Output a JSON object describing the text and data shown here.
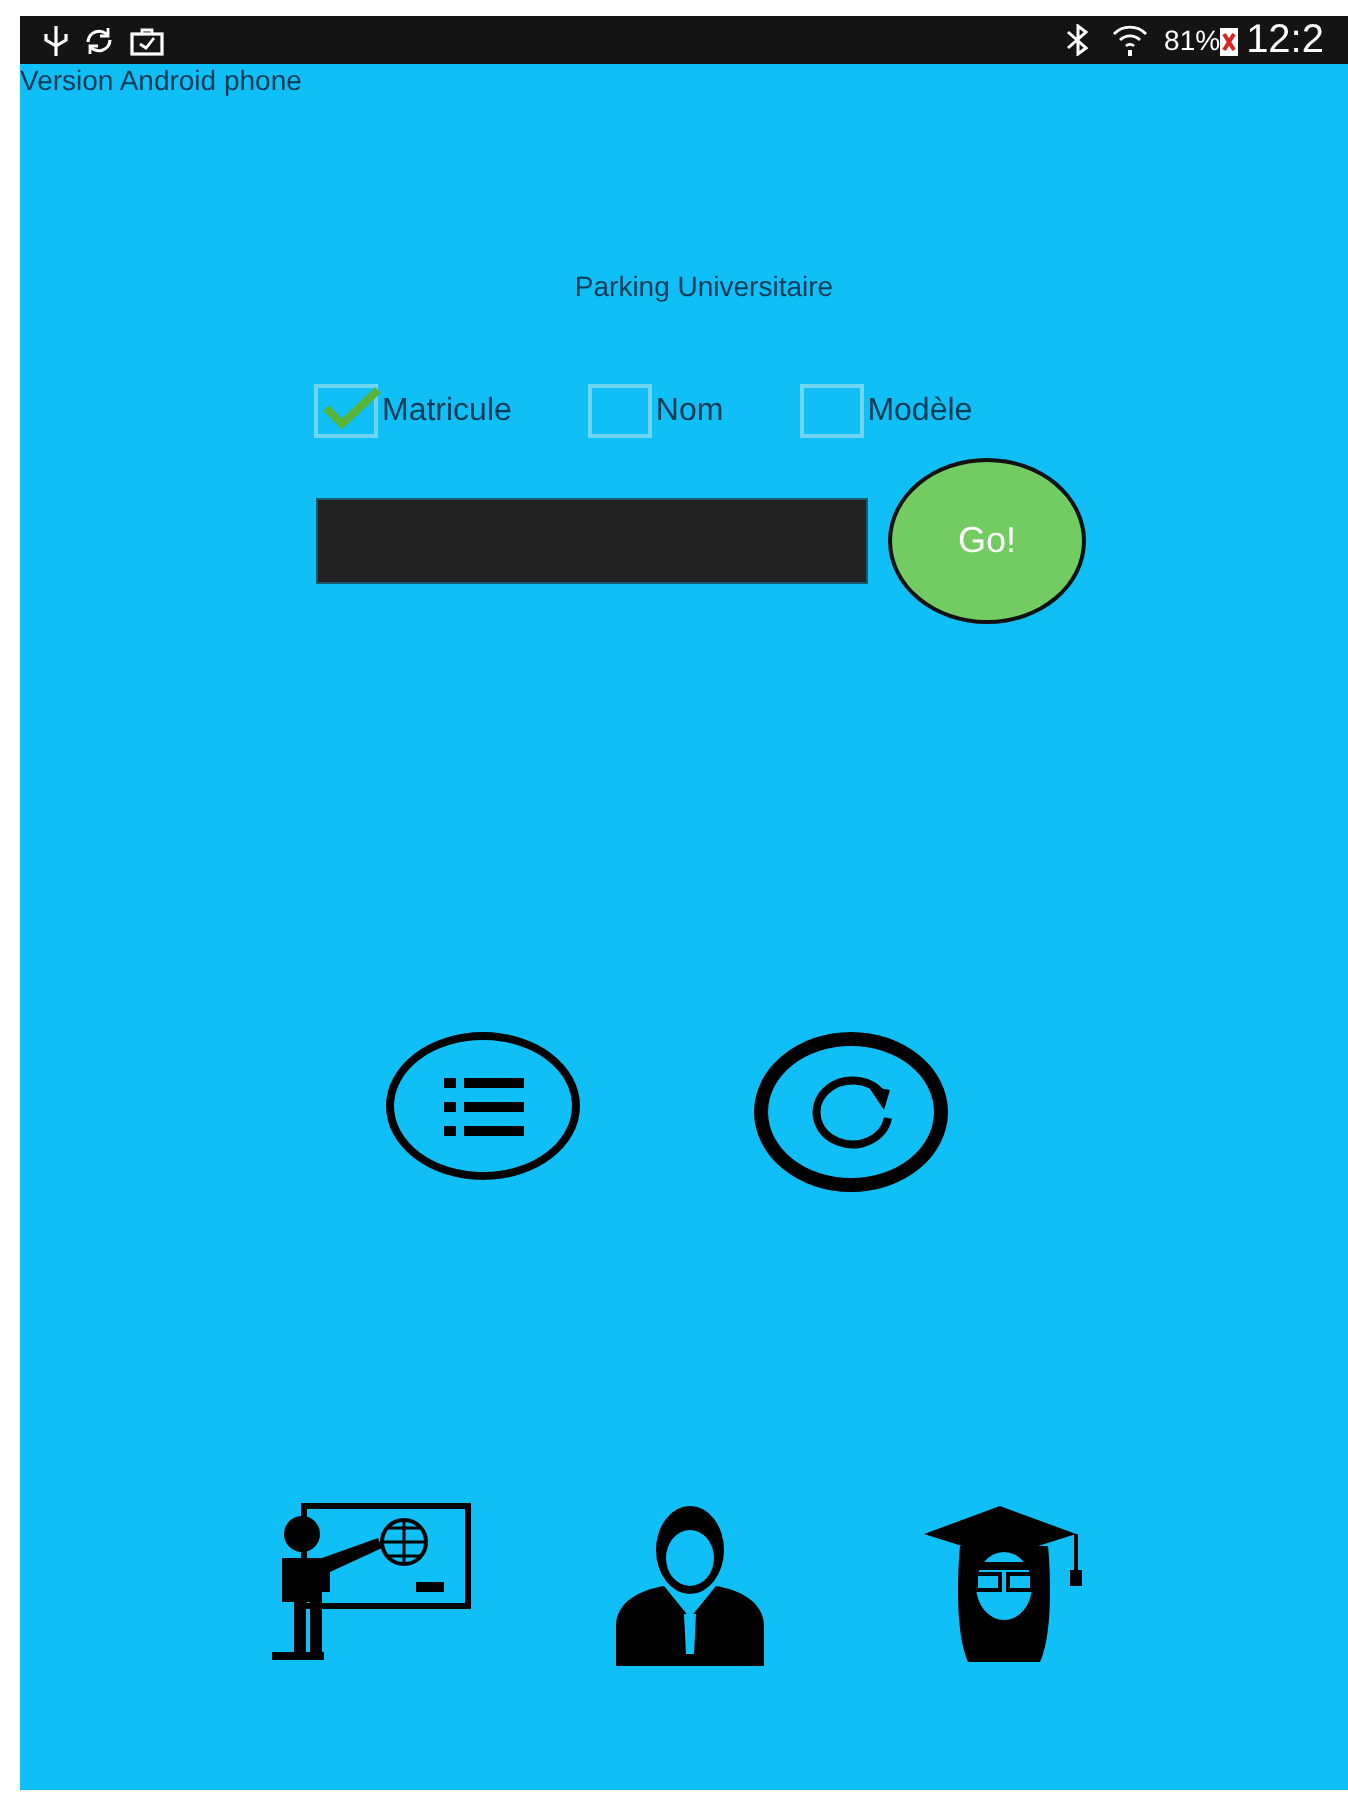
{
  "status_bar": {
    "battery": "81%",
    "time": "12:2"
  },
  "app_label": "Version Android phone",
  "title": "Parking Universitaire",
  "search_options": [
    {
      "label": "Matricule",
      "checked": true
    },
    {
      "label": "Nom",
      "checked": false
    },
    {
      "label": "Modèle",
      "checked": false
    }
  ],
  "go_button": "Go!"
}
